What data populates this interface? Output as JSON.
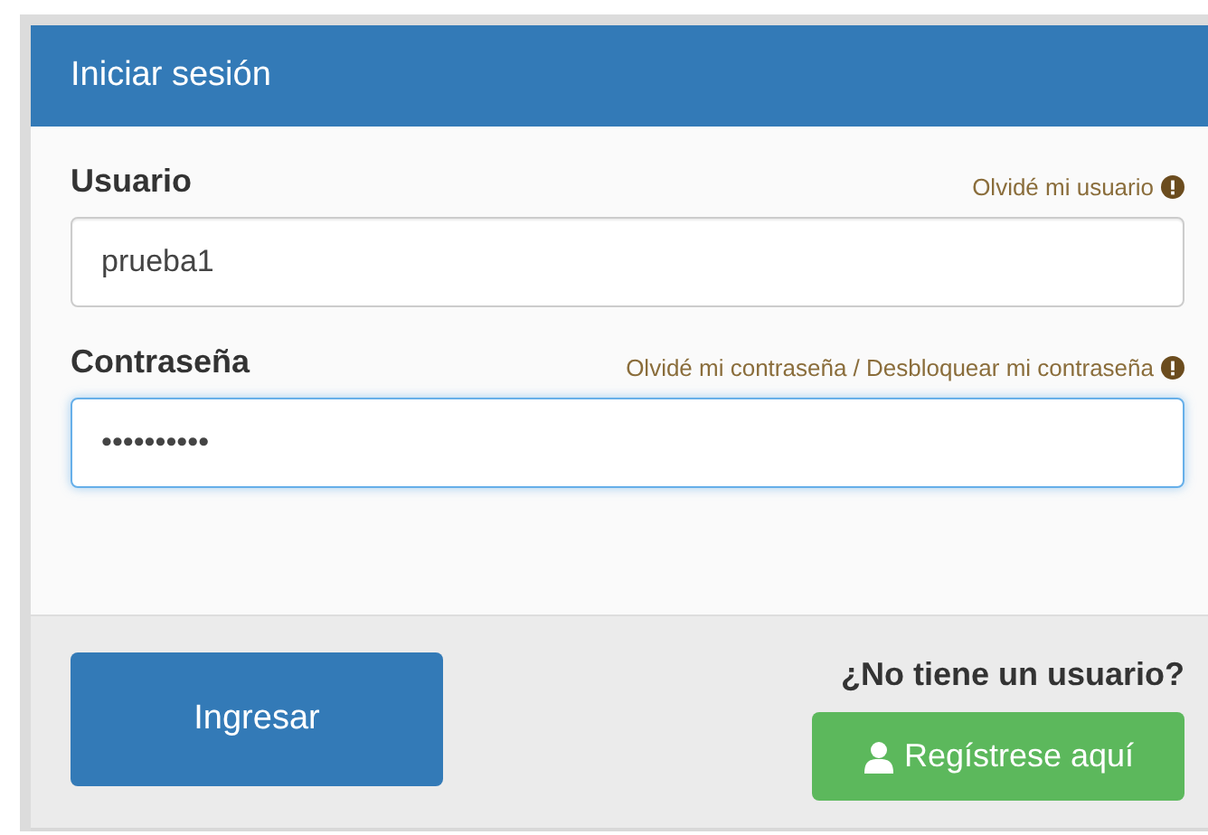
{
  "panel": {
    "title": "Iniciar sesión"
  },
  "fields": [
    {
      "label": "Usuario",
      "link": "Olvidé mi usuario",
      "value": "prueba1",
      "focused": false
    },
    {
      "label": "Contraseña",
      "link": "Olvidé mi contraseña / Desbloquear mi contraseña",
      "value": "••••••••••",
      "focused": true
    }
  ],
  "footer": {
    "login_button": "Ingresar",
    "prompt": "¿No tiene un usuario?",
    "register_button": "Regístrese aquí"
  }
}
